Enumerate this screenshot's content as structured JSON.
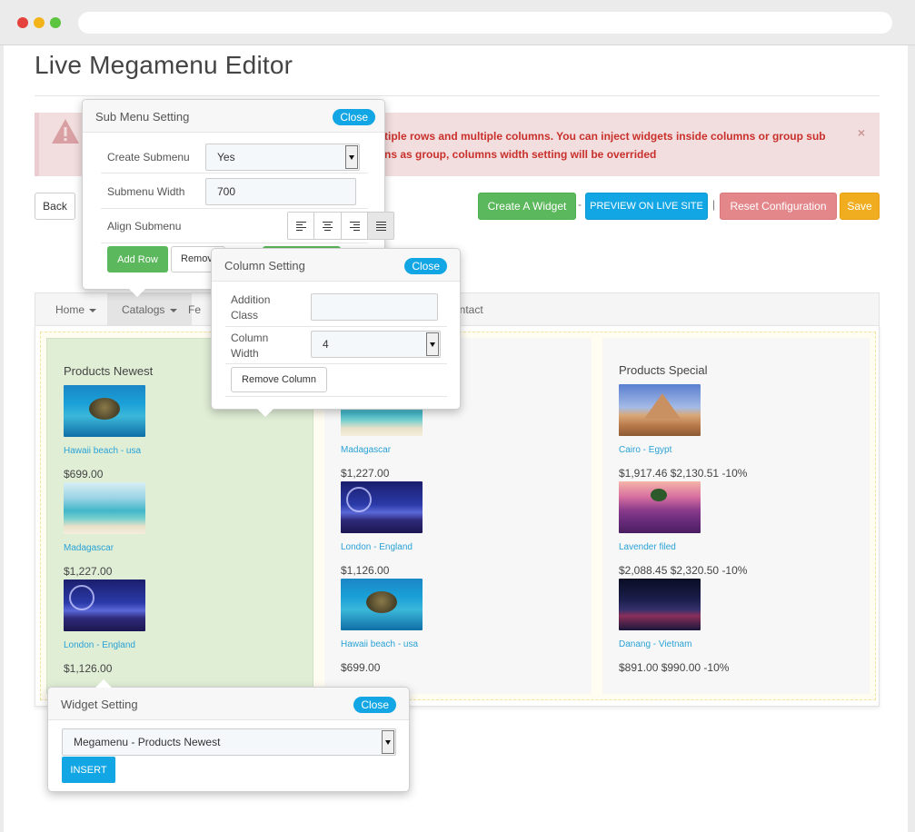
{
  "page": {
    "title": "Live Megamenu Editor"
  },
  "alert": {
    "line1": "tiple rows and multiple columns. You can inject widgets inside columns or group sub",
    "line2": "ns as group, columns width setting will be overrided",
    "close": "×"
  },
  "toolbar": {
    "back": "Back",
    "create_widget": "Create A Widget",
    "sep1": "-",
    "preview": "PREVIEW ON LIVE SITE",
    "sep2": "|",
    "reset": "Reset Configuration",
    "save": "Save"
  },
  "colors": {
    "green": "#5cb85c",
    "blue": "#13a6e4",
    "red": "#e3878b",
    "orange": "#f0ad20",
    "link": "#29a2d6"
  },
  "nav": {
    "home": "Home",
    "catalogs": "Catalogs",
    "fe": "Fe",
    "contact": "ontact"
  },
  "columns": [
    {
      "title": "Products Newest",
      "products": [
        {
          "name": "Hawaii beach - usa",
          "price": "$699.00",
          "image": "turtle"
        },
        {
          "name": "Madagascar",
          "price": "$1,227.00",
          "image": "beach"
        },
        {
          "name": "London - England",
          "price": "$1,126.00",
          "image": "london"
        }
      ]
    },
    {
      "title": "",
      "products": [
        {
          "name": "Madagascar",
          "price": "$1,227.00",
          "image": "beach"
        },
        {
          "name": "London - England",
          "price": "$1,126.00",
          "image": "london"
        },
        {
          "name": "Hawaii beach - usa",
          "price": "$699.00",
          "image": "turtle"
        }
      ]
    },
    {
      "title": "Products Special",
      "products": [
        {
          "name": "Cairo - Egypt",
          "price": "$1,917.46 $2,130.51 -10%",
          "image": "cairo"
        },
        {
          "name": "Lavender filed",
          "price": "$2,088.45 $2,320.50 -10%",
          "image": "lavender"
        },
        {
          "name": "Danang - Vietnam",
          "price": "$891.00 $990.00 -10%",
          "image": "danang"
        }
      ]
    }
  ],
  "submenu_popup": {
    "title": "Sub Menu Setting",
    "close": "Close",
    "create_label": "Create Submenu",
    "create_value": "Yes",
    "width_label": "Submenu Width",
    "width_value": "700",
    "align_label": "Align Submenu",
    "add_row": "Add Row",
    "remove": "Remov"
  },
  "column_popup": {
    "title": "Column Setting",
    "close": "Close",
    "class_label": "Addition Class",
    "class_value": "",
    "width_label": "Column Width",
    "width_value": "4",
    "remove_column": "Remove Column"
  },
  "widget_popup": {
    "title": "Widget Setting",
    "close": "Close",
    "selected": "Megamenu - Products Newest",
    "insert": "INSERT"
  }
}
